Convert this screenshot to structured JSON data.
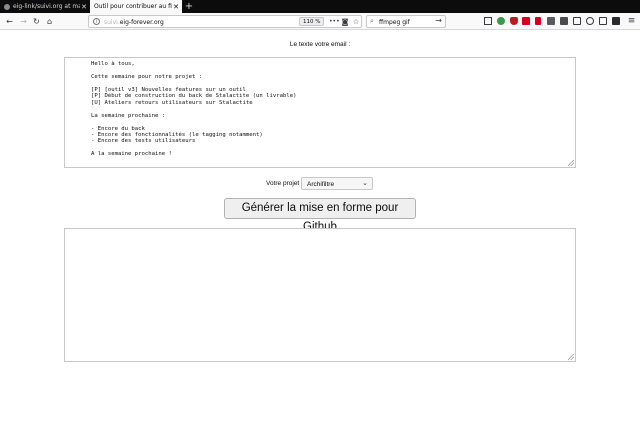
{
  "browser": {
    "tabs": [
      {
        "label": "eig-link/suivi.org at mas",
        "active": false
      },
      {
        "label": "Outil pour contribuer au fic",
        "active": true
      }
    ],
    "url_scheme_text": "suivi.",
    "url_host_text": "eig-forever.org",
    "zoom": "110 %",
    "search_value": "ffmpeg gif",
    "icons": {
      "back": "←",
      "forward": "→",
      "reload": "↻",
      "home": "⌂",
      "page_actions": "•••",
      "pocket": "◙",
      "bookmark": "☆",
      "search": "⌕",
      "go": "→",
      "menu": "≡"
    }
  },
  "page": {
    "email_label": "Le texte votre email :",
    "email_text": "Hello à tous,\n\nCette semaine pour notre projet :\n\n[P] [outil v3] Nouvelles features sur un outil\n[P] Début de construction du back de Stalactite (un livrable)\n[U] Ateliers retours utilisateurs sur Stalactite\n\nLa semaine prochaine :\n\n- Encore du back\n- Encore des fonctionnalités (le tagging notamment)\n- Encore des tests utilisateurs\n\nA la semaine prochaine !",
    "project_label": "Votre projet :",
    "project_selected": "Archifiltre",
    "generate_button": "Générer la mise en forme pour Github",
    "output_text": ""
  },
  "colors": {
    "tabbar_bg": "#0c0c0d",
    "active_tab_bg": "#f9f9fa",
    "toolbar_bg": "#f9f9fa"
  }
}
